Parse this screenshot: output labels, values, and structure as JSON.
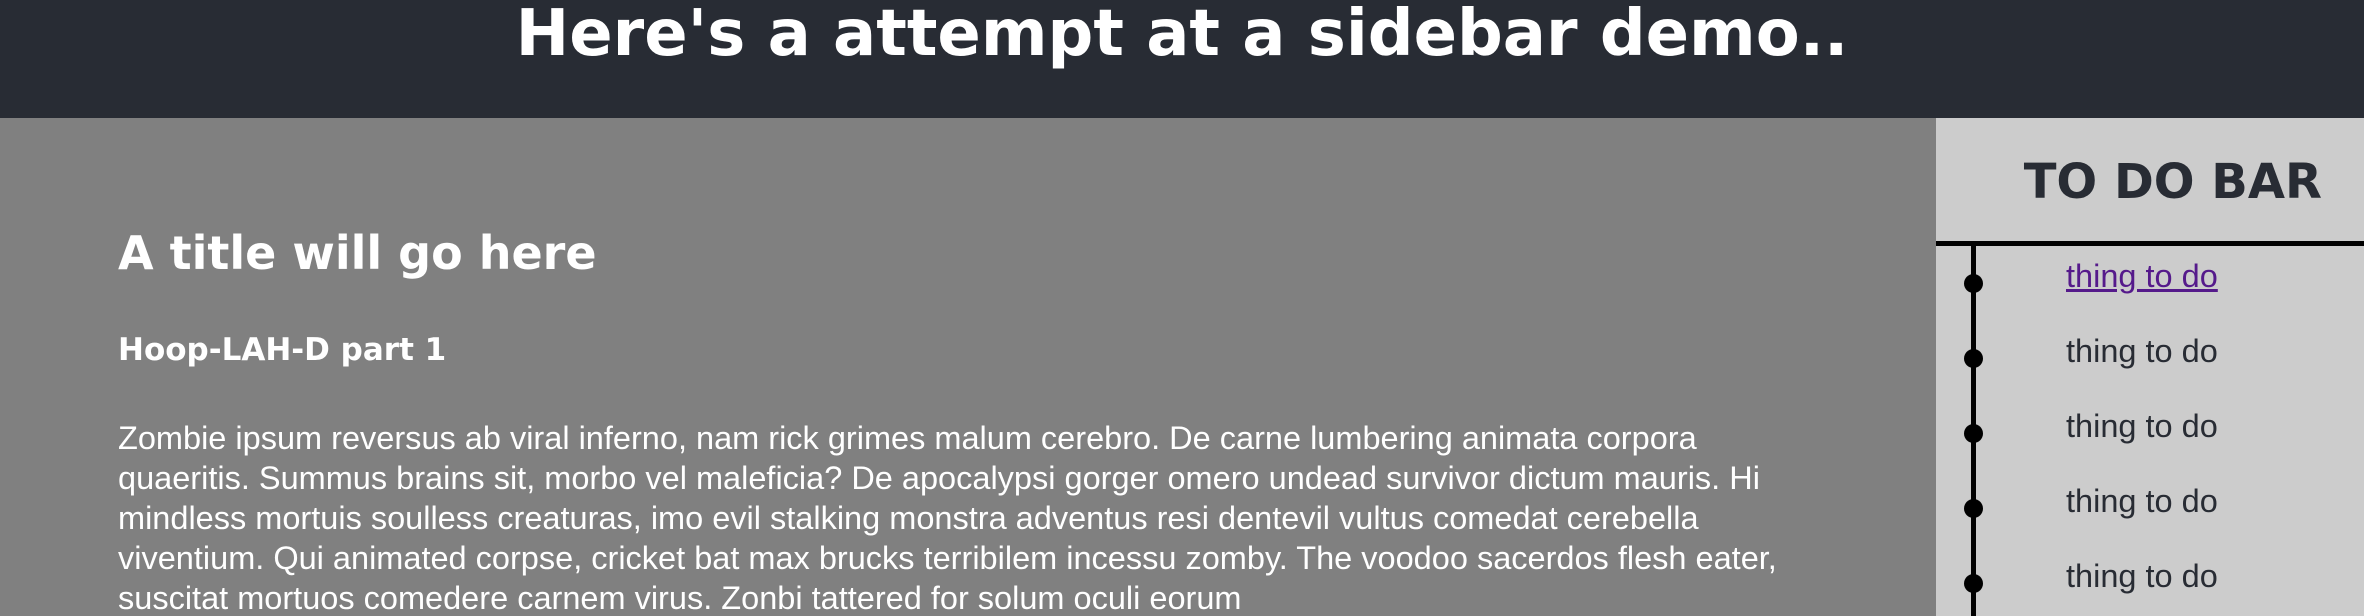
{
  "header": {
    "title": "Here's a attempt at a sidebar demo.."
  },
  "main": {
    "title": "A title will go here",
    "subtitle": "Hoop-LAH-D part 1",
    "body": "Zombie ipsum reversus ab viral inferno, nam rick grimes malum cerebro. De carne lumbering animata corpora quaeritis. Summus brains sit, morbo vel maleficia? De apocalypsi gorger omero undead survivor dictum mauris. Hi mindless mortuis soulless creaturas, imo evil stalking monstra adventus resi dentevil vultus comedat cerebella viventium. Qui animated corpse, cricket bat max brucks terribilem incessu zomby. The voodoo sacerdos flesh eater, suscitat mortuos comedere carnem virus. Zonbi tattered for solum oculi eorum"
  },
  "sidebar": {
    "title": "TO DO BAR",
    "items": [
      {
        "label": "thing to do"
      },
      {
        "label": "thing to do"
      },
      {
        "label": "thing to do"
      },
      {
        "label": "thing to do"
      },
      {
        "label": "thing to do"
      }
    ]
  },
  "colors": {
    "header_bg": "#282c34",
    "main_bg": "#808080",
    "sidebar_bg": "#cccccc",
    "link_visited": "#551a8b"
  }
}
